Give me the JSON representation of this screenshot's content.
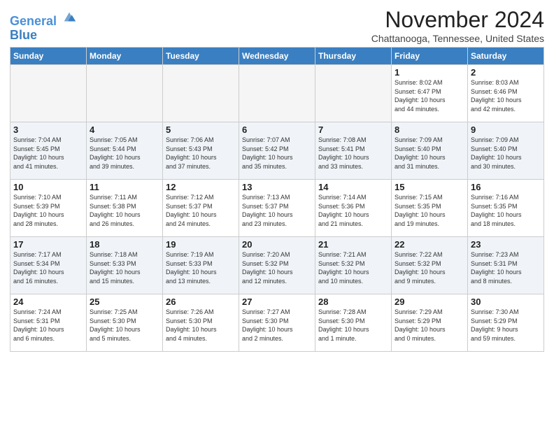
{
  "header": {
    "logo_line1": "General",
    "logo_line2": "Blue",
    "month_title": "November 2024",
    "location": "Chattanooga, Tennessee, United States"
  },
  "days_of_week": [
    "Sunday",
    "Monday",
    "Tuesday",
    "Wednesday",
    "Thursday",
    "Friday",
    "Saturday"
  ],
  "weeks": [
    [
      {
        "day": "",
        "info": "",
        "empty": true
      },
      {
        "day": "",
        "info": "",
        "empty": true
      },
      {
        "day": "",
        "info": "",
        "empty": true
      },
      {
        "day": "",
        "info": "",
        "empty": true
      },
      {
        "day": "",
        "info": "",
        "empty": true
      },
      {
        "day": "1",
        "info": "Sunrise: 8:02 AM\nSunset: 6:47 PM\nDaylight: 10 hours\nand 44 minutes.",
        "empty": false
      },
      {
        "day": "2",
        "info": "Sunrise: 8:03 AM\nSunset: 6:46 PM\nDaylight: 10 hours\nand 42 minutes.",
        "empty": false
      }
    ],
    [
      {
        "day": "3",
        "info": "Sunrise: 7:04 AM\nSunset: 5:45 PM\nDaylight: 10 hours\nand 41 minutes.",
        "empty": false
      },
      {
        "day": "4",
        "info": "Sunrise: 7:05 AM\nSunset: 5:44 PM\nDaylight: 10 hours\nand 39 minutes.",
        "empty": false
      },
      {
        "day": "5",
        "info": "Sunrise: 7:06 AM\nSunset: 5:43 PM\nDaylight: 10 hours\nand 37 minutes.",
        "empty": false
      },
      {
        "day": "6",
        "info": "Sunrise: 7:07 AM\nSunset: 5:42 PM\nDaylight: 10 hours\nand 35 minutes.",
        "empty": false
      },
      {
        "day": "7",
        "info": "Sunrise: 7:08 AM\nSunset: 5:41 PM\nDaylight: 10 hours\nand 33 minutes.",
        "empty": false
      },
      {
        "day": "8",
        "info": "Sunrise: 7:09 AM\nSunset: 5:40 PM\nDaylight: 10 hours\nand 31 minutes.",
        "empty": false
      },
      {
        "day": "9",
        "info": "Sunrise: 7:09 AM\nSunset: 5:40 PM\nDaylight: 10 hours\nand 30 minutes.",
        "empty": false
      }
    ],
    [
      {
        "day": "10",
        "info": "Sunrise: 7:10 AM\nSunset: 5:39 PM\nDaylight: 10 hours\nand 28 minutes.",
        "empty": false
      },
      {
        "day": "11",
        "info": "Sunrise: 7:11 AM\nSunset: 5:38 PM\nDaylight: 10 hours\nand 26 minutes.",
        "empty": false
      },
      {
        "day": "12",
        "info": "Sunrise: 7:12 AM\nSunset: 5:37 PM\nDaylight: 10 hours\nand 24 minutes.",
        "empty": false
      },
      {
        "day": "13",
        "info": "Sunrise: 7:13 AM\nSunset: 5:37 PM\nDaylight: 10 hours\nand 23 minutes.",
        "empty": false
      },
      {
        "day": "14",
        "info": "Sunrise: 7:14 AM\nSunset: 5:36 PM\nDaylight: 10 hours\nand 21 minutes.",
        "empty": false
      },
      {
        "day": "15",
        "info": "Sunrise: 7:15 AM\nSunset: 5:35 PM\nDaylight: 10 hours\nand 19 minutes.",
        "empty": false
      },
      {
        "day": "16",
        "info": "Sunrise: 7:16 AM\nSunset: 5:35 PM\nDaylight: 10 hours\nand 18 minutes.",
        "empty": false
      }
    ],
    [
      {
        "day": "17",
        "info": "Sunrise: 7:17 AM\nSunset: 5:34 PM\nDaylight: 10 hours\nand 16 minutes.",
        "empty": false
      },
      {
        "day": "18",
        "info": "Sunrise: 7:18 AM\nSunset: 5:33 PM\nDaylight: 10 hours\nand 15 minutes.",
        "empty": false
      },
      {
        "day": "19",
        "info": "Sunrise: 7:19 AM\nSunset: 5:33 PM\nDaylight: 10 hours\nand 13 minutes.",
        "empty": false
      },
      {
        "day": "20",
        "info": "Sunrise: 7:20 AM\nSunset: 5:32 PM\nDaylight: 10 hours\nand 12 minutes.",
        "empty": false
      },
      {
        "day": "21",
        "info": "Sunrise: 7:21 AM\nSunset: 5:32 PM\nDaylight: 10 hours\nand 10 minutes.",
        "empty": false
      },
      {
        "day": "22",
        "info": "Sunrise: 7:22 AM\nSunset: 5:32 PM\nDaylight: 10 hours\nand 9 minutes.",
        "empty": false
      },
      {
        "day": "23",
        "info": "Sunrise: 7:23 AM\nSunset: 5:31 PM\nDaylight: 10 hours\nand 8 minutes.",
        "empty": false
      }
    ],
    [
      {
        "day": "24",
        "info": "Sunrise: 7:24 AM\nSunset: 5:31 PM\nDaylight: 10 hours\nand 6 minutes.",
        "empty": false
      },
      {
        "day": "25",
        "info": "Sunrise: 7:25 AM\nSunset: 5:30 PM\nDaylight: 10 hours\nand 5 minutes.",
        "empty": false
      },
      {
        "day": "26",
        "info": "Sunrise: 7:26 AM\nSunset: 5:30 PM\nDaylight: 10 hours\nand 4 minutes.",
        "empty": false
      },
      {
        "day": "27",
        "info": "Sunrise: 7:27 AM\nSunset: 5:30 PM\nDaylight: 10 hours\nand 2 minutes.",
        "empty": false
      },
      {
        "day": "28",
        "info": "Sunrise: 7:28 AM\nSunset: 5:30 PM\nDaylight: 10 hours\nand 1 minute.",
        "empty": false
      },
      {
        "day": "29",
        "info": "Sunrise: 7:29 AM\nSunset: 5:29 PM\nDaylight: 10 hours\nand 0 minutes.",
        "empty": false
      },
      {
        "day": "30",
        "info": "Sunrise: 7:30 AM\nSunset: 5:29 PM\nDaylight: 9 hours\nand 59 minutes.",
        "empty": false
      }
    ]
  ]
}
